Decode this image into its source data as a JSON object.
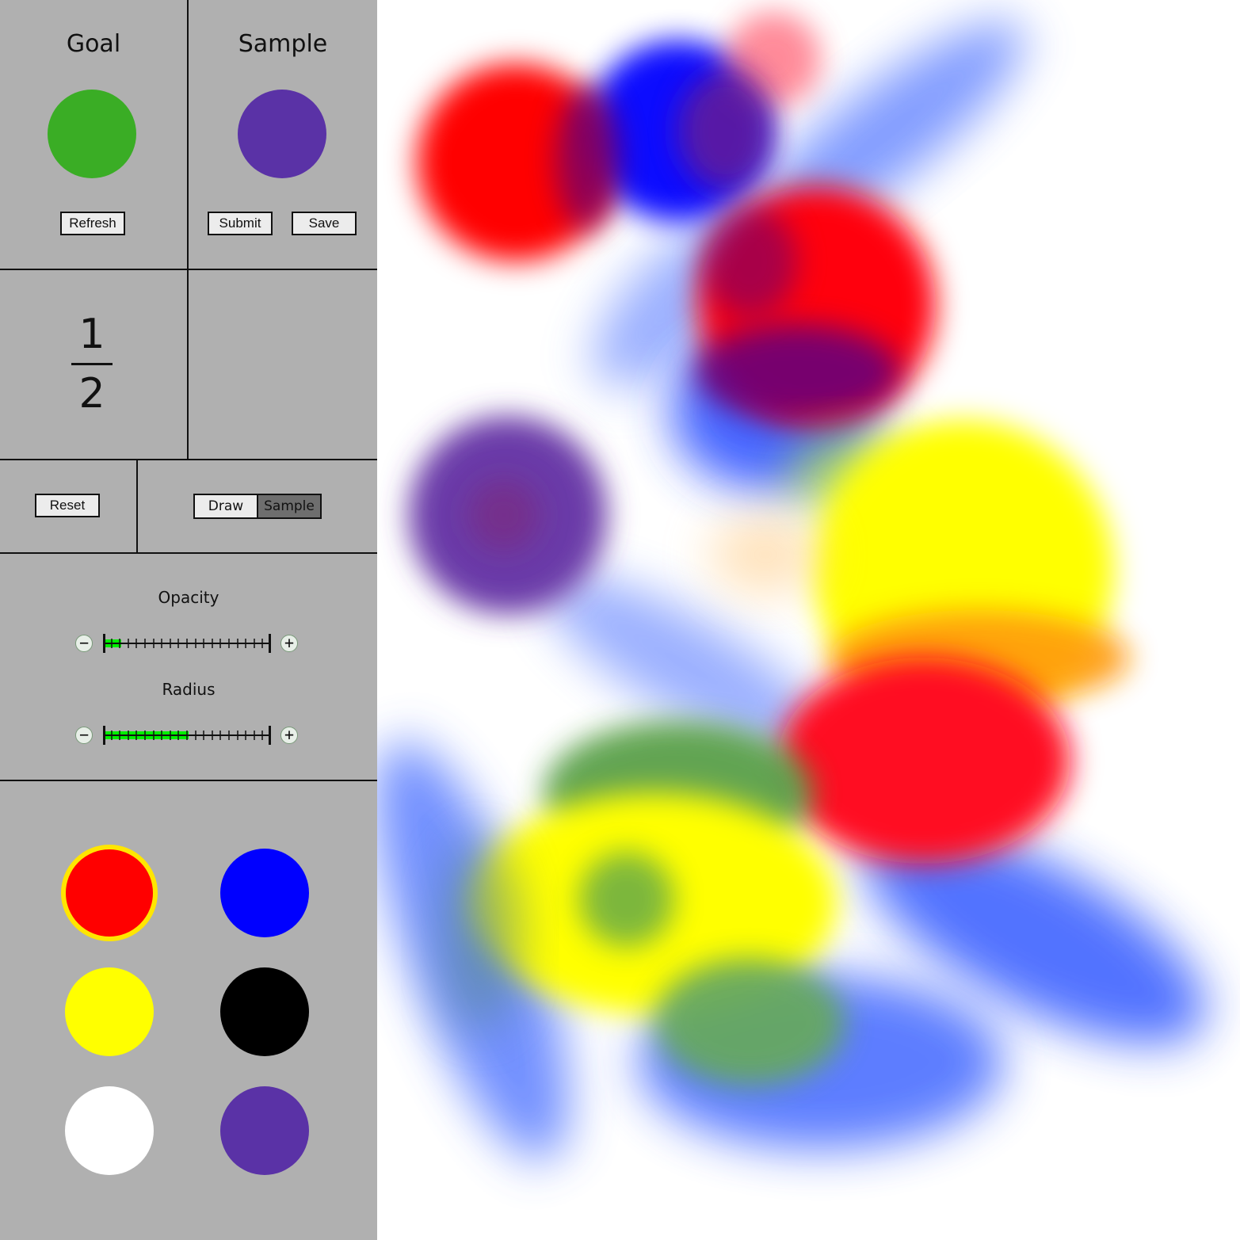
{
  "goal": {
    "heading": "Goal",
    "color": "#3aad25",
    "refresh_label": "Refresh"
  },
  "sample": {
    "heading": "Sample",
    "color": "#5a32a6",
    "submit_label": "Submit",
    "save_label": "Save"
  },
  "progress": {
    "numerator": "1",
    "denominator": "2"
  },
  "controls": {
    "reset_label": "Reset",
    "mode": {
      "options": [
        "Draw",
        "Sample"
      ],
      "selected": "Sample"
    }
  },
  "sliders": {
    "opacity": {
      "label": "Opacity",
      "value_fraction": 0.1,
      "minus": "−",
      "plus": "+"
    },
    "radius": {
      "label": "Radius",
      "value_fraction": 0.5,
      "minus": "−",
      "plus": "+"
    }
  },
  "palette": {
    "selected": "red",
    "colors": [
      {
        "name": "red",
        "hex": "#ff0000"
      },
      {
        "name": "blue",
        "hex": "#0000ff"
      },
      {
        "name": "yellow",
        "hex": "#ffff00"
      },
      {
        "name": "black",
        "hex": "#000000"
      },
      {
        "name": "white",
        "hex": "#ffffff"
      },
      {
        "name": "purple",
        "hex": "#5a32a6"
      }
    ]
  },
  "canvas": {
    "background": "#ffffff"
  }
}
